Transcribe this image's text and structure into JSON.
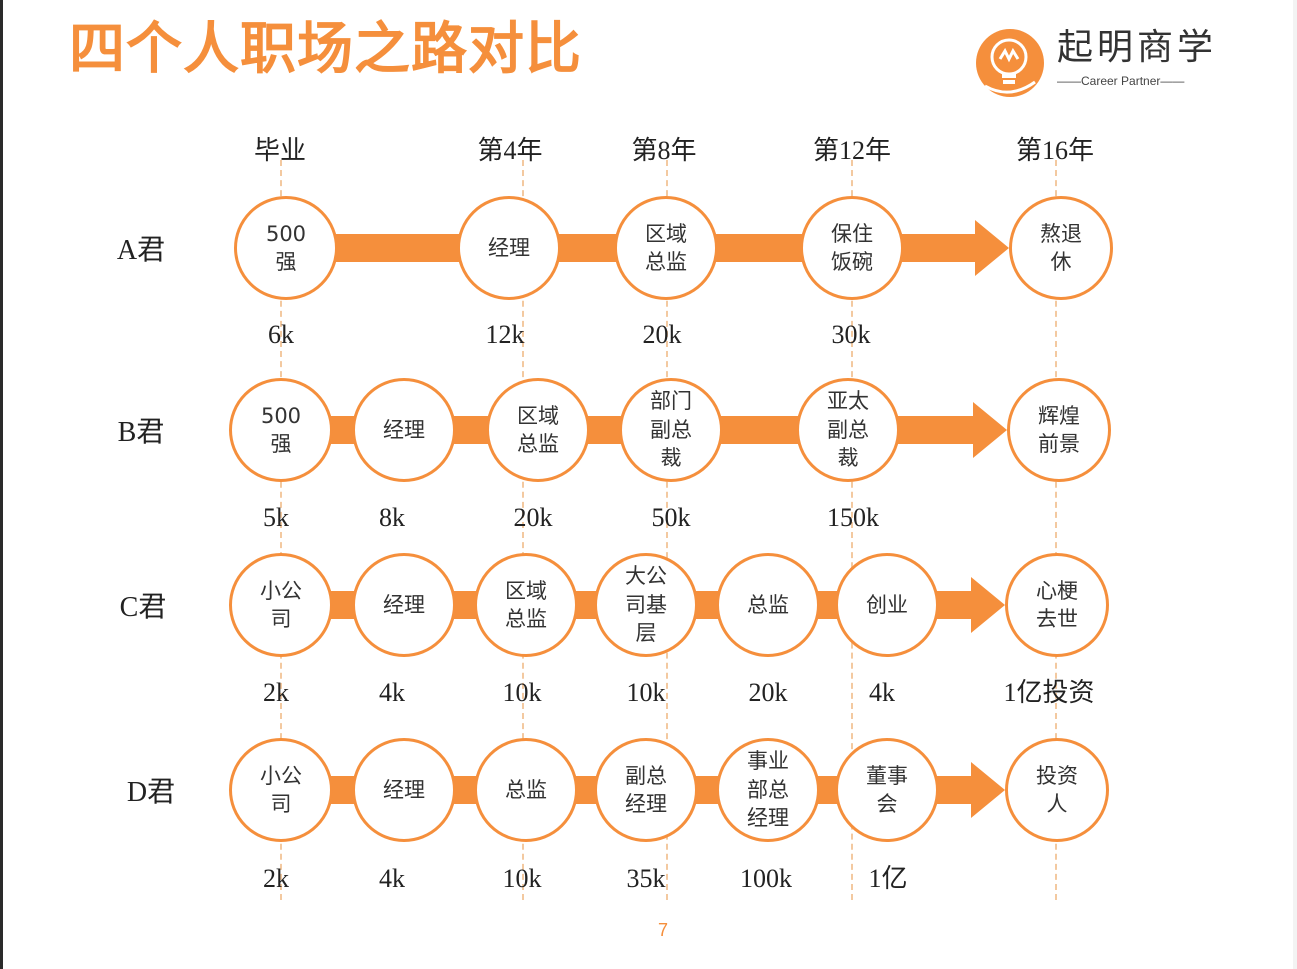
{
  "title": "四个人职场之路对比",
  "logo": {
    "name_cn": "起明商学",
    "name_en": "Career Partner",
    "accent": "#f58f3c"
  },
  "timeline": [
    "毕业",
    "第4年",
    "第8年",
    "第12年",
    "第16年"
  ],
  "rows": [
    {
      "label": "A君",
      "nodes": [
        {
          "text": "500\n强",
          "salary": "6k"
        },
        {
          "text": "经理",
          "salary": "12k"
        },
        {
          "text": "区域\n总监",
          "salary": "20k"
        },
        {
          "text": "保住\n饭碗",
          "salary": "30k"
        },
        {
          "text": "熬退\n休",
          "salary": ""
        }
      ]
    },
    {
      "label": "B君",
      "nodes": [
        {
          "text": "500\n强",
          "salary": "5k"
        },
        {
          "text": "经理",
          "salary": "8k"
        },
        {
          "text": "区域\n总监",
          "salary": "20k"
        },
        {
          "text": "部门\n副总\n裁",
          "salary": "50k"
        },
        {
          "text": "亚太\n副总\n裁",
          "salary": "150k"
        },
        {
          "text": "辉煌\n前景",
          "salary": ""
        }
      ]
    },
    {
      "label": "C君",
      "nodes": [
        {
          "text": "小公\n司",
          "salary": "2k"
        },
        {
          "text": "经理",
          "salary": "4k"
        },
        {
          "text": "区域\n总监",
          "salary": "10k"
        },
        {
          "text": "大公\n司基\n层",
          "salary": "10k"
        },
        {
          "text": "总监",
          "salary": "20k"
        },
        {
          "text": "创业",
          "salary": "4k"
        },
        {
          "text": "心梗\n去世",
          "salary": "1亿投资"
        }
      ]
    },
    {
      "label": "D君",
      "nodes": [
        {
          "text": "小公\n司",
          "salary": "2k"
        },
        {
          "text": "经理",
          "salary": "4k"
        },
        {
          "text": "总监",
          "salary": "10k"
        },
        {
          "text": "副总\n经理",
          "salary": "35k"
        },
        {
          "text": "事业\n部总\n经理",
          "salary": "100k"
        },
        {
          "text": "董事\n会",
          "salary": "1亿"
        },
        {
          "text": "投资\n人",
          "salary": ""
        }
      ]
    }
  ],
  "page_number": "7"
}
